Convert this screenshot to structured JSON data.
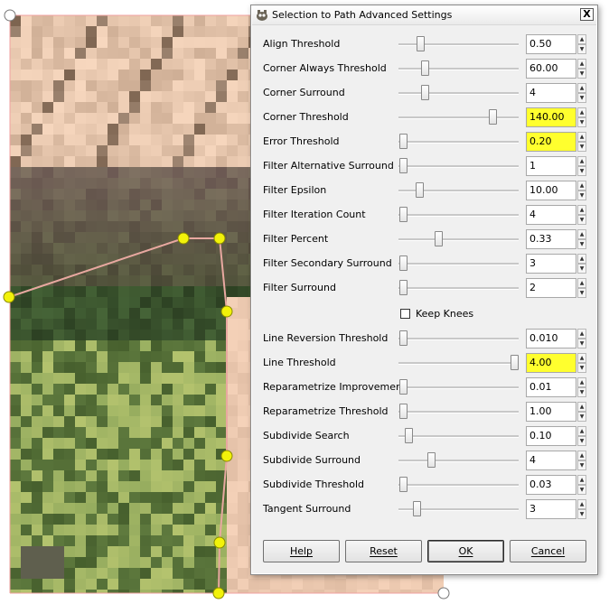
{
  "dialog": {
    "title": "Selection to Path Advanced Settings",
    "close_label": "X",
    "app_icon": "gimp-icon"
  },
  "settings": [
    {
      "label": "Align Threshold",
      "value": "0.50",
      "slider_fraction": 0.18,
      "highlight": false
    },
    {
      "label": "Corner Always Threshold",
      "value": "60.00",
      "slider_fraction": 0.22,
      "highlight": false
    },
    {
      "label": "Corner Surround",
      "value": "4",
      "slider_fraction": 0.22,
      "highlight": false
    },
    {
      "label": "Corner Threshold",
      "value": "140.00",
      "slider_fraction": 0.78,
      "highlight": true
    },
    {
      "label": "Error Threshold",
      "value": "0.20",
      "slider_fraction": 0.04,
      "highlight": true
    },
    {
      "label": "Filter Alternative Surround",
      "value": "1",
      "slider_fraction": 0.04,
      "highlight": false
    },
    {
      "label": "Filter Epsilon",
      "value": "10.00",
      "slider_fraction": 0.17,
      "highlight": false
    },
    {
      "label": "Filter Iteration Count",
      "value": "4",
      "slider_fraction": 0.04,
      "highlight": false
    },
    {
      "label": "Filter Percent",
      "value": "0.33",
      "slider_fraction": 0.33,
      "highlight": false
    },
    {
      "label": "Filter Secondary Surround",
      "value": "3",
      "slider_fraction": 0.04,
      "highlight": false
    },
    {
      "label": "Filter Surround",
      "value": "2",
      "slider_fraction": 0.04,
      "highlight": false
    }
  ],
  "keep_knees": {
    "label": "Keep Knees",
    "checked": false
  },
  "settings2": [
    {
      "label": "Line Reversion Threshold",
      "value": "0.010",
      "slider_fraction": 0.04,
      "highlight": false
    },
    {
      "label": "Line Threshold",
      "value": "4.00",
      "slider_fraction": 0.96,
      "highlight": true
    },
    {
      "label": "Reparametrize Improvement",
      "value": "0.01",
      "slider_fraction": 0.04,
      "highlight": false
    },
    {
      "label": "Reparametrize Threshold",
      "value": "1.00",
      "slider_fraction": 0.04,
      "highlight": false
    },
    {
      "label": "Subdivide Search",
      "value": "0.10",
      "slider_fraction": 0.08,
      "highlight": false
    },
    {
      "label": "Subdivide Surround",
      "value": "4",
      "slider_fraction": 0.27,
      "highlight": false
    },
    {
      "label": "Subdivide Threshold",
      "value": "0.03",
      "slider_fraction": 0.04,
      "highlight": false
    },
    {
      "label": "Tangent Surround",
      "value": "3",
      "slider_fraction": 0.15,
      "highlight": false
    }
  ],
  "buttons": {
    "help": "Help",
    "reset": "Reset",
    "ok": "OK",
    "cancel": "Cancel"
  },
  "colors": {
    "highlight": "#ffff2e",
    "path_stroke": "#e8a8a0",
    "anchor_fill": "#f2f20a",
    "frame_line": "#f0a0a0"
  }
}
